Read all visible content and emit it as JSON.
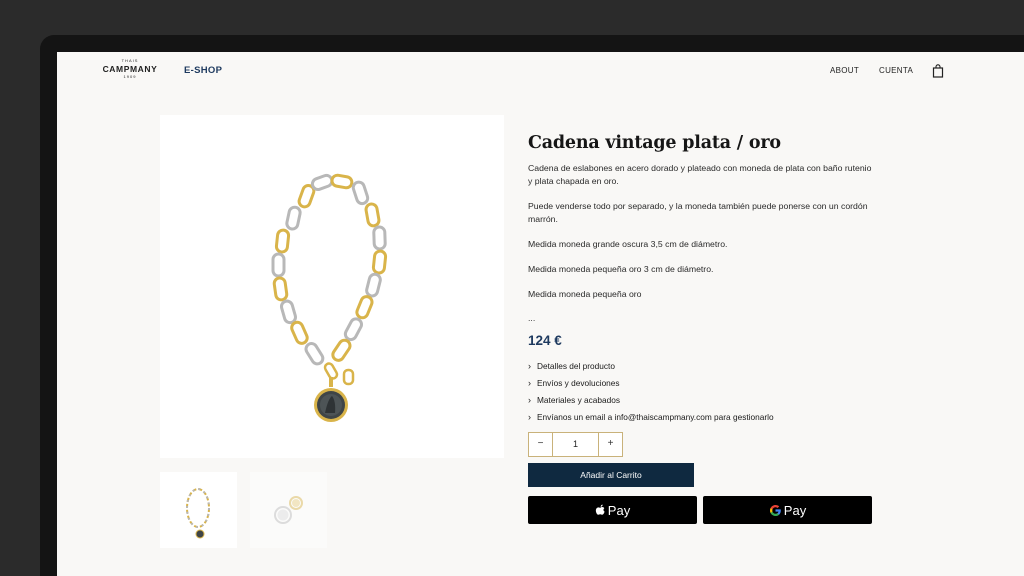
{
  "header": {
    "logo_top": "THAIS",
    "logo_name": "CAMPMANY",
    "logo_year": "1909",
    "eshop": "E-SHOP",
    "nav_about": "ABOUT",
    "nav_account": "CUENTA",
    "cart_icon": "shopping-bag-icon"
  },
  "product": {
    "title": "Cadena vintage plata / oro",
    "description": [
      "Cadena de eslabones en acero dorado y plateado con moneda de plata con baño rutenio y plata chapada en oro.",
      "Puede venderse todo por separado, y la moneda también puede ponerse con un cordón marrón.",
      "Medida moneda grande oscura 3,5 cm de diámetro.",
      "Medida moneda pequeña oro 3 cm de diámetro.",
      "Medida moneda pequeña oro",
      "..."
    ],
    "price": "124 €",
    "accordion": [
      "Detalles del producto",
      "Envíos y devoluciones",
      "Materiales y acabados",
      "Envíanos un email a info@thaiscampmany.com para gestionarlo"
    ],
    "quantity": "1",
    "qty_minus": "−",
    "qty_plus": "+",
    "add_to_cart": "Añadir al Carrito",
    "apple_pay": "Pay",
    "google_pay": "Pay"
  },
  "colors": {
    "accent": "#1e3a5f",
    "cart_button": "#0f2940",
    "gold": "#d9b44a",
    "silver": "#b8b8b8",
    "qty_border": "#c9b27a"
  }
}
